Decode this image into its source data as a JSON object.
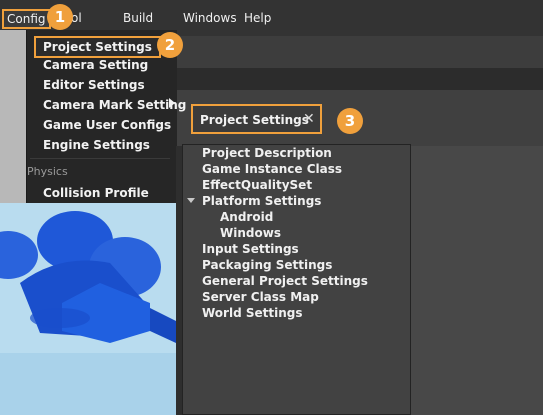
{
  "menubar": {
    "config_label": "Config",
    "obscured_label": "ol",
    "build_label": "Build",
    "windows_label": "Windows",
    "help_label": "Help"
  },
  "dropdown": {
    "items": [
      "Project Settings",
      "Camera Setting",
      "Editor Settings",
      "Camera Mark Setting",
      "Game User Configs",
      "Engine Settings"
    ],
    "section_label": "Physics",
    "section_items": [
      "Collision Profile"
    ]
  },
  "badges": [
    "1",
    "2",
    "3"
  ],
  "tab": {
    "label": "Project Settings",
    "close_glyph": "✕"
  },
  "tree": {
    "items": [
      "Project Description",
      "Game Instance Class",
      "EffectQualitySet",
      "Platform Settings",
      "Android",
      "Windows",
      "Input Settings",
      "Packaging Settings",
      "General Project Settings",
      "Server Class Map",
      "World Settings"
    ]
  },
  "colors": {
    "highlight": "#f0a03c",
    "menubar_bg": "#333333",
    "dropdown_bg": "#262626",
    "panel_bg": "#424242",
    "viewport_sky": "#b9dcef",
    "object_blue": "#1a56d6"
  },
  "icons": {
    "submenu": "chevron-right-icon",
    "expander": "caret-down-icon",
    "close": "close-icon"
  }
}
